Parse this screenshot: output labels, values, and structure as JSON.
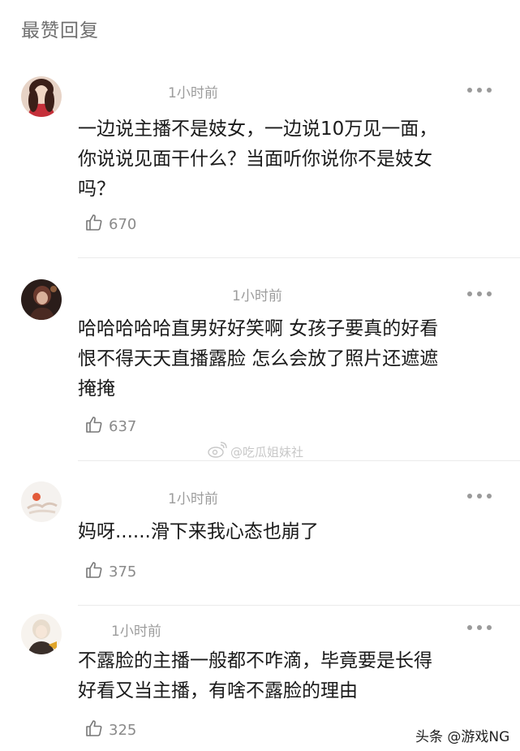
{
  "header": {
    "title": "最赞回复"
  },
  "comments": [
    {
      "time": "1小时前",
      "lines": [
        "一边说主播不是妓女，一边说10万见一面，",
        "你说说见面干什么？当面听你说你不是妓女",
        "吗？"
      ],
      "likes": "670",
      "avatar_icon": "user-avatar-woman"
    },
    {
      "time": "1小时前",
      "lines": [
        "哈哈哈哈哈直男好好笑啊 女孩子要真的好看",
        "恨不得天天直播露脸 怎么会放了照片还遮遮",
        "掩掩"
      ],
      "likes": "637",
      "avatar_icon": "user-avatar-dark"
    },
    {
      "time": "1小时前",
      "lines": [
        "妈呀......滑下来我心态也崩了"
      ],
      "likes": "375",
      "avatar_icon": "user-avatar-sun"
    },
    {
      "time": "1小时前",
      "lines": [
        "不露脸的主播一般都不咋滴，毕竟要是长得",
        "好看又当主播，有啥不露脸的理由"
      ],
      "likes": "325",
      "avatar_icon": "user-avatar-cartoon"
    }
  ],
  "watermark": {
    "text": "@吃瓜姐妹社",
    "icon": "weibo-icon"
  },
  "footer": {
    "brand": "头条 @游戏NG"
  },
  "icons": {
    "more": "more-dots-icon",
    "like": "thumbs-up-icon"
  },
  "colors": {
    "text": "#1a1a1a",
    "meta": "#9c9c9c",
    "title": "#6f6f6f"
  }
}
